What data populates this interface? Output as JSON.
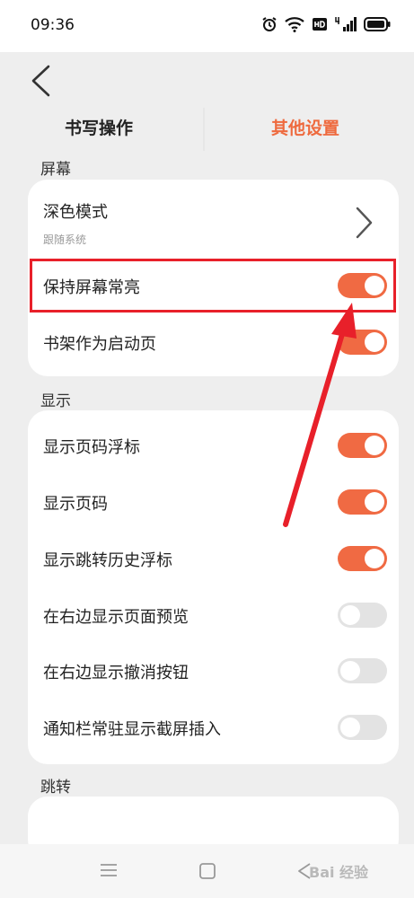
{
  "status": {
    "time": "09:36"
  },
  "tabs": {
    "writing": "书写操作",
    "other": "其他设置"
  },
  "sections": {
    "screen": {
      "title": "屏幕",
      "items": [
        {
          "label": "深色模式",
          "sub": "跟随系统",
          "control": "chevron"
        },
        {
          "label": "保持屏幕常亮",
          "control": "toggle",
          "on": true
        },
        {
          "label": "书架作为启动页",
          "control": "toggle",
          "on": true
        }
      ]
    },
    "display": {
      "title": "显示",
      "items": [
        {
          "label": "显示页码浮标",
          "on": true
        },
        {
          "label": "显示页码",
          "on": true
        },
        {
          "label": "显示跳转历史浮标",
          "on": true
        },
        {
          "label": "在右边显示页面预览",
          "on": false
        },
        {
          "label": "在右边显示撤消按钮",
          "on": false
        },
        {
          "label": "通知栏常驻显示截屏插入",
          "on": false
        }
      ]
    },
    "jump": {
      "title": "跳转"
    }
  },
  "colors": {
    "accent": "#f06a43",
    "highlight": "#e8202a"
  },
  "watermark": "Bai 经验"
}
